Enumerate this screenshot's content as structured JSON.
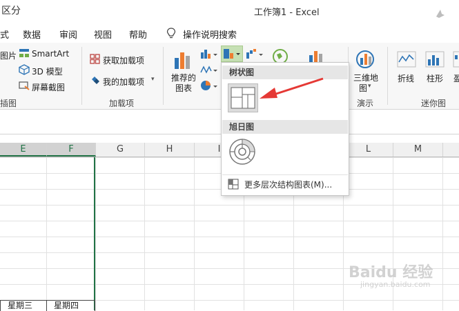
{
  "window": {
    "title": "工作簿1  -  Excel"
  },
  "menu": {
    "tabs": [
      "式",
      "数据",
      "审阅",
      "视图",
      "帮助"
    ],
    "tell_me": "操作说明搜索"
  },
  "ribbon": {
    "illustrations": {
      "picture": "图片",
      "smartart": "SmartArt",
      "model3d": "3D 模型",
      "screenshot": "屏幕截图",
      "group": "插图"
    },
    "addins": {
      "get": "获取加载项",
      "mine": "我的加载项",
      "group": "加载项"
    },
    "charts": {
      "recommended_line1": "推荐的",
      "recommended_line2": "图表"
    },
    "tours": {
      "map_line1": "三维地",
      "map_line2": "图",
      "group": "演示"
    },
    "sparklines": {
      "line": "折线",
      "column": "柱形",
      "winloss": "盈",
      "group": "迷你图"
    }
  },
  "formula_bar": {
    "text": "区分"
  },
  "columns": [
    {
      "label": "E",
      "selected": true
    },
    {
      "label": "F",
      "selected": true
    },
    {
      "label": "G",
      "selected": false
    },
    {
      "label": "H",
      "selected": false
    },
    {
      "label": "I",
      "selected": false
    },
    {
      "label": "L",
      "selected": false
    },
    {
      "label": "M",
      "selected": false
    }
  ],
  "cells": {
    "e_bottom": "星期三",
    "f_bottom": "星期四"
  },
  "dropdown": {
    "treemap_header": "树状图",
    "sunburst_header": "旭日图",
    "more": "更多层次结构图表(M)..."
  },
  "watermark": {
    "brand": "Baidu 经验",
    "url": "jingyan.baidu.com"
  },
  "colors": {
    "excel_green": "#217346",
    "arrow_red": "#e53935",
    "chart_blue": "#2e75b6",
    "chart_orange": "#ed7d31"
  }
}
